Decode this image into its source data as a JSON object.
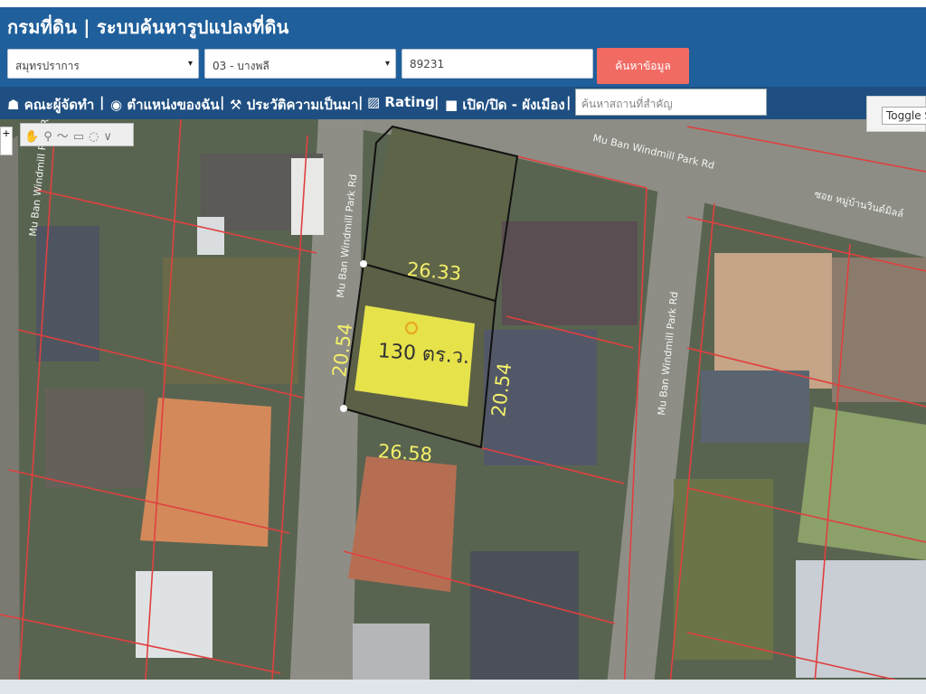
{
  "app": {
    "title": "กรมที่ดิน | ระบบค้นหารูปแปลงที่ดิน"
  },
  "search": {
    "province": "สมุทรปราการ",
    "district": "03 - บางพลี",
    "parcel_no": "89231",
    "button_label": "ค้นหาข้อมูล"
  },
  "toolbar": {
    "items": [
      "คณะผู้จัดทำ",
      "ตำแหน่งของฉัน",
      "ประวัติความเป็นมา",
      "Rating",
      "เปิด/ปิด - ผังเมือง"
    ],
    "separators": [
      "|",
      "|",
      "|",
      "|",
      "|"
    ],
    "search_placeholder": "ค้นหาสถานที่สำคัญ",
    "toggle_label": "Toggle St"
  },
  "map": {
    "parcel": {
      "area_label": "130 ตร.ว.",
      "side_top": "26.33",
      "side_bottom": "26.58",
      "side_left": "20.54",
      "side_right": "20.54"
    },
    "roads": [
      "Mu Ban Windmill Park Rd",
      "Mu Ban Windmill Park Rd",
      "Mu Ban Windmill Park Rd",
      "Mu Ban Windmill Park Rd",
      "ซอย หมู่บ้านวินด์มิลล์"
    ],
    "colors": {
      "parcel_highlight": "#e6e24a",
      "parcel_label": "#f3ef6a",
      "boundary": "#e0403f"
    }
  }
}
